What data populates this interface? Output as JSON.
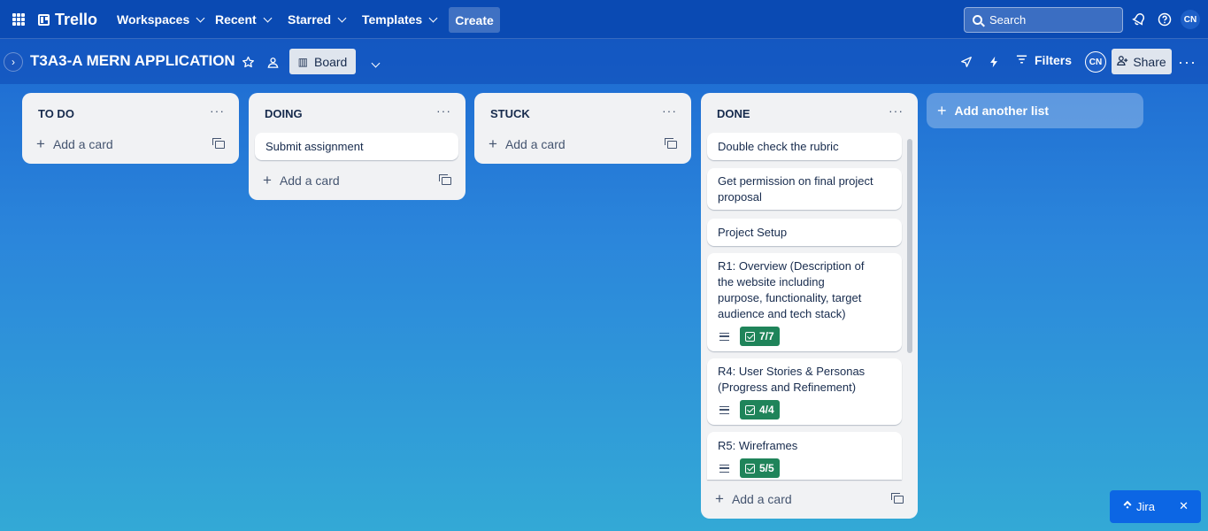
{
  "topnav": {
    "brand": "Trello",
    "workspaces": "Workspaces",
    "recent": "Recent",
    "starred": "Starred",
    "templates": "Templates",
    "create": "Create",
    "search_label": "Search",
    "avatar_initials": "CN"
  },
  "board": {
    "title": "T3A3-A MERN APPLICATION",
    "view_label": "Board",
    "filters_label": "Filters",
    "share_label": "Share",
    "member_initials": "CN"
  },
  "lists": [
    {
      "title": "TO DO",
      "cards": [],
      "add_label": "Add a card"
    },
    {
      "title": "DOING",
      "cards": [
        {
          "title": "Submit assignment"
        }
      ],
      "add_label": "Add a card"
    },
    {
      "title": "STUCK",
      "cards": [],
      "add_label": "Add a card"
    },
    {
      "title": "DONE",
      "add_label": "Add a card",
      "cards": [
        {
          "title": "Double check the rubric"
        },
        {
          "title": "Get permission on final project proposal"
        },
        {
          "title": "Project Setup"
        },
        {
          "title": "R1: Overview (Description of the website including purpose, functionality, target audience and tech stack)",
          "checklist": "7/7",
          "has_description": true
        },
        {
          "title": "R4: User Stories & Personas (Progress and Refinement)",
          "checklist": "4/4",
          "has_description": true
        },
        {
          "title": "R5: Wireframes",
          "checklist": "5/5",
          "has_description": true
        }
      ]
    }
  ],
  "add_list_label": "Add another list",
  "jira_label": "Jira",
  "icons": {
    "apps": "grid-icon",
    "notifications": "bell-icon",
    "help": "help-icon",
    "star": "star-icon",
    "visibility": "workspace-visibility-icon",
    "power_ups": "rocket-icon",
    "automation": "lightning-icon",
    "filter": "filter-icon",
    "more": "ellipsis-icon"
  },
  "colors": {
    "topnav": "#0a4ab3",
    "checklist_complete": "#1f845a",
    "jira": "#0c66e4"
  }
}
